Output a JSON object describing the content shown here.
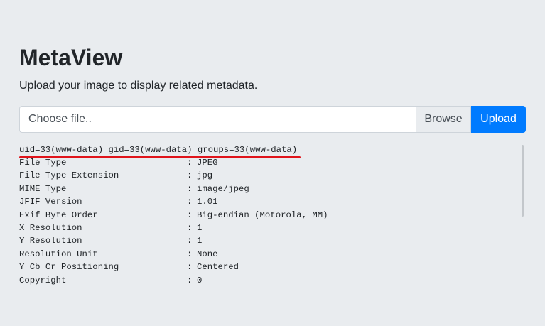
{
  "app": {
    "title": "MetaView",
    "subtitle": "Upload your image to display related metadata."
  },
  "upload": {
    "file_placeholder": "Choose file..",
    "browse_label": "Browse",
    "upload_label": "Upload"
  },
  "output": {
    "id_line": "uid=33(www-data) gid=33(www-data) groups=33(www-data)",
    "separator": ":",
    "rows": [
      {
        "key": "File Type",
        "value": "JPEG"
      },
      {
        "key": "File Type Extension",
        "value": "jpg"
      },
      {
        "key": "MIME Type",
        "value": "image/jpeg"
      },
      {
        "key": "JFIF Version",
        "value": "1.01"
      },
      {
        "key": "Exif Byte Order",
        "value": "Big-endian (Motorola, MM)"
      },
      {
        "key": "X Resolution",
        "value": "1"
      },
      {
        "key": "Y Resolution",
        "value": "1"
      },
      {
        "key": "Resolution Unit",
        "value": "None"
      },
      {
        "key": "Y Cb Cr Positioning",
        "value": "Centered"
      },
      {
        "key": "Copyright",
        "value": "0"
      }
    ]
  },
  "colors": {
    "background": "#e9ecef",
    "primary": "#007bff",
    "annotation_underline": "#e0141b"
  }
}
